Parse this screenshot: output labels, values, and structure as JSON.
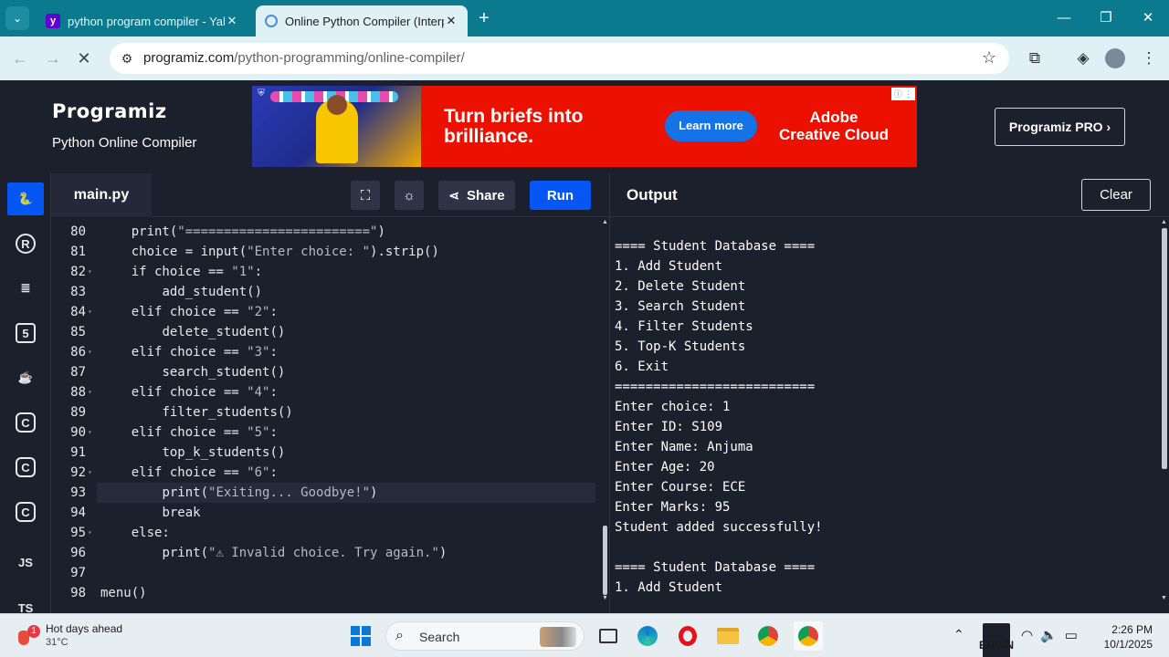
{
  "browser": {
    "tabs": [
      {
        "title": "python program compiler - Yah",
        "favicon": "yahoo-icon",
        "active": false
      },
      {
        "title": "Online Python Compiler (Interp",
        "favicon": "programiz-icon",
        "active": true
      }
    ],
    "url_domain": "programiz.com",
    "url_path": "/python-programming/online-compiler/",
    "accent_color": "#0b7a8f"
  },
  "site": {
    "brand": "Programiz",
    "subtitle": "Python Online Compiler",
    "pro_button": "Programiz PRO ›"
  },
  "ad": {
    "headline": "Turn briefs into brilliance.",
    "cta": "Learn more",
    "brand": "Adobe Creative Cloud"
  },
  "languages": [
    {
      "name": "python-icon",
      "label": "",
      "active": true
    },
    {
      "name": "r-icon",
      "label": "R"
    },
    {
      "name": "sql-icon",
      "label": ""
    },
    {
      "name": "html-icon",
      "label": "5"
    },
    {
      "name": "java-icon",
      "label": ""
    },
    {
      "name": "c-icon",
      "label": "C"
    },
    {
      "name": "cplusplus-icon",
      "label": "C"
    },
    {
      "name": "csharp-icon",
      "label": "C"
    },
    {
      "name": "js-icon",
      "label": "JS"
    },
    {
      "name": "ts-icon",
      "label": "TS"
    }
  ],
  "editor": {
    "filename": "main.py",
    "share_label": "Share",
    "run_label": "Run",
    "run_color": "#0556f3",
    "lines": [
      {
        "n": "80",
        "fold": false,
        "indent": "    ",
        "code": "print(",
        "str": "\"========================\"",
        "tail": ")"
      },
      {
        "n": "81",
        "fold": false,
        "indent": "    ",
        "code": "choice = input(",
        "str": "\"Enter choice: \"",
        "tail": ").strip()"
      },
      {
        "n": "82",
        "fold": true,
        "indent": "    ",
        "code": "if choice == ",
        "str": "\"1\"",
        "tail": ":"
      },
      {
        "n": "83",
        "fold": false,
        "indent": "        ",
        "code": "add_student()",
        "str": "",
        "tail": ""
      },
      {
        "n": "84",
        "fold": true,
        "indent": "    ",
        "code": "elif choice == ",
        "str": "\"2\"",
        "tail": ":"
      },
      {
        "n": "85",
        "fold": false,
        "indent": "        ",
        "code": "delete_student()",
        "str": "",
        "tail": ""
      },
      {
        "n": "86",
        "fold": true,
        "indent": "    ",
        "code": "elif choice == ",
        "str": "\"3\"",
        "tail": ":"
      },
      {
        "n": "87",
        "fold": false,
        "indent": "        ",
        "code": "search_student()",
        "str": "",
        "tail": ""
      },
      {
        "n": "88",
        "fold": true,
        "indent": "    ",
        "code": "elif choice == ",
        "str": "\"4\"",
        "tail": ":"
      },
      {
        "n": "89",
        "fold": false,
        "indent": "        ",
        "code": "filter_students()",
        "str": "",
        "tail": ""
      },
      {
        "n": "90",
        "fold": true,
        "indent": "    ",
        "code": "elif choice == ",
        "str": "\"5\"",
        "tail": ":"
      },
      {
        "n": "91",
        "fold": false,
        "indent": "        ",
        "code": "top_k_students()",
        "str": "",
        "tail": ""
      },
      {
        "n": "92",
        "fold": true,
        "indent": "    ",
        "code": "elif choice == ",
        "str": "\"6\"",
        "tail": ":"
      },
      {
        "n": "93",
        "fold": false,
        "indent": "        ",
        "code": "print(",
        "str": "\"Exiting... Goodbye!\"",
        "tail": ")",
        "current": true
      },
      {
        "n": "94",
        "fold": false,
        "indent": "        ",
        "code": "break",
        "str": "",
        "tail": ""
      },
      {
        "n": "95",
        "fold": true,
        "indent": "    ",
        "code": "else:",
        "str": "",
        "tail": ""
      },
      {
        "n": "96",
        "fold": false,
        "indent": "        ",
        "code": "print(",
        "str": "\"⚠ Invalid choice. Try again.\"",
        "tail": ")"
      },
      {
        "n": "97",
        "fold": false,
        "indent": "",
        "code": "",
        "str": "",
        "tail": ""
      },
      {
        "n": "98",
        "fold": false,
        "indent": "",
        "code": "menu()",
        "str": "",
        "tail": ""
      }
    ]
  },
  "output": {
    "title": "Output",
    "clear_label": "Clear",
    "lines": [
      "==== Student Database ====",
      "1. Add Student",
      "2. Delete Student",
      "3. Search Student",
      "4. Filter Students",
      "5. Top-K Students",
      "6. Exit",
      "==========================",
      "Enter choice: 1",
      "Enter ID: S109",
      "Enter Name: Anjuma",
      "Enter Age: 20",
      "Enter Course: ECE",
      "Enter Marks: 95",
      "Student added successfully!",
      "",
      "==== Student Database ====",
      "1. Add Student"
    ]
  },
  "taskbar": {
    "weather_title": "Hot days ahead",
    "weather_temp": "31°C",
    "weather_badge": "1",
    "search_label": "Search",
    "lang_line1": "ENG",
    "lang_line2": "IN",
    "time": "2:26 PM",
    "date": "10/1/2025"
  }
}
